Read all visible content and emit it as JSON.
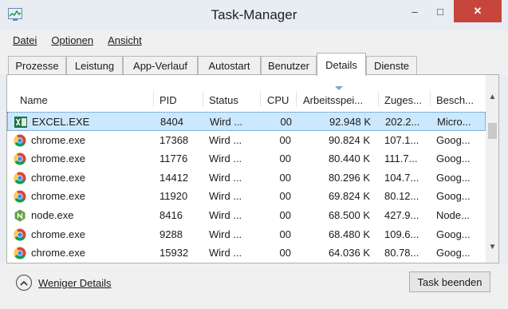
{
  "window": {
    "title": "Task-Manager",
    "minimize_glyph": "–",
    "maximize_glyph": "□",
    "close_glyph": "✕"
  },
  "menu": [
    {
      "label": "Datei"
    },
    {
      "label": "Optionen"
    },
    {
      "label": "Ansicht"
    }
  ],
  "tabs": [
    {
      "label": "Prozesse"
    },
    {
      "label": "Leistung"
    },
    {
      "label": "App-Verlauf"
    },
    {
      "label": "Autostart"
    },
    {
      "label": "Benutzer"
    },
    {
      "label": "Details",
      "active": true
    },
    {
      "label": "Dienste"
    }
  ],
  "table": {
    "columns": [
      "Name",
      "PID",
      "Status",
      "CPU",
      "Arbeitsspei...",
      "Zuges...",
      "Besch..."
    ],
    "rows": [
      {
        "icon": "excel-icon",
        "name": "EXCEL.EXE",
        "pid": "8404",
        "status": "Wird ...",
        "cpu": "00",
        "mem": "92.948 K",
        "commit": "202.2...",
        "desc": "Micro...",
        "selected": true
      },
      {
        "icon": "chrome-icon",
        "name": "chrome.exe",
        "pid": "17368",
        "status": "Wird ...",
        "cpu": "00",
        "mem": "90.824 K",
        "commit": "107.1...",
        "desc": "Goog..."
      },
      {
        "icon": "chrome-icon",
        "name": "chrome.exe",
        "pid": "11776",
        "status": "Wird ...",
        "cpu": "00",
        "mem": "80.440 K",
        "commit": "111.7...",
        "desc": "Goog..."
      },
      {
        "icon": "chrome-icon",
        "name": "chrome.exe",
        "pid": "14412",
        "status": "Wird ...",
        "cpu": "00",
        "mem": "80.296 K",
        "commit": "104.7...",
        "desc": "Goog..."
      },
      {
        "icon": "chrome-icon",
        "name": "chrome.exe",
        "pid": "11920",
        "status": "Wird ...",
        "cpu": "00",
        "mem": "69.824 K",
        "commit": "80.12...",
        "desc": "Goog..."
      },
      {
        "icon": "node-icon",
        "name": "node.exe",
        "pid": "8416",
        "status": "Wird ...",
        "cpu": "00",
        "mem": "68.500 K",
        "commit": "427.9...",
        "desc": "Node..."
      },
      {
        "icon": "chrome-icon",
        "name": "chrome.exe",
        "pid": "9288",
        "status": "Wird ...",
        "cpu": "00",
        "mem": "68.480 K",
        "commit": "109.6...",
        "desc": "Goog..."
      },
      {
        "icon": "chrome-icon",
        "name": "chrome.exe",
        "pid": "15932",
        "status": "Wird ...",
        "cpu": "00",
        "mem": "64.036 K",
        "commit": "80.78...",
        "desc": "Goog..."
      }
    ]
  },
  "footer": {
    "fewer_details": "Weniger Details",
    "end_task": "Task beenden"
  },
  "colors": {
    "selection": "#cce8ff",
    "close_button": "#c7463b",
    "excel_green": "#1e7145",
    "node_green": "#68a046"
  }
}
